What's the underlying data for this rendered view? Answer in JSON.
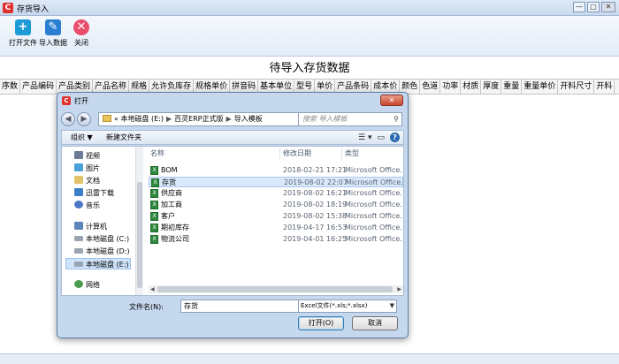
{
  "app": {
    "title": "存货导入",
    "window_buttons": [
      "—",
      "□",
      "✕"
    ]
  },
  "toolbar": {
    "items": [
      {
        "label": "打开文件",
        "icon": "add-file-icon",
        "glyph": "+"
      },
      {
        "label": "导入数据",
        "icon": "edit-import-icon",
        "glyph": "✎"
      },
      {
        "label": "关闭",
        "icon": "close-circle-icon",
        "glyph": "✕"
      }
    ]
  },
  "grid": {
    "title": "待导入存货数据",
    "columns": [
      "序数",
      "产品编码",
      "产品类别",
      "产品名称",
      "规格",
      "允许负库存",
      "规格单价",
      "拼音码",
      "基本单位",
      "型号",
      "单价",
      "产品条码",
      "成本价",
      "颜色",
      "色道",
      "功率",
      "材质",
      "厚度",
      "重量",
      "重量单价",
      "开料尺寸",
      "开料"
    ]
  },
  "dialog": {
    "title": "打开",
    "close_glyph": "✕",
    "address": {
      "prefix": "«",
      "parts": [
        "本地磁盘 (E:)",
        "百灵ERP正式版",
        "导入模板"
      ]
    },
    "search_placeholder": "搜索 导入模板",
    "commands": {
      "organize": "组织 ▼",
      "new_folder": "新建文件夹"
    },
    "nav_items": [
      {
        "label": "视频",
        "icon": "video-icon",
        "cls": "ni-video"
      },
      {
        "label": "图片",
        "icon": "picture-icon",
        "cls": "ni-pic"
      },
      {
        "label": "文档",
        "icon": "document-icon",
        "cls": "ni-doc"
      },
      {
        "label": "迅雷下载",
        "icon": "download-icon",
        "cls": "ni-dl"
      },
      {
        "label": "音乐",
        "icon": "music-icon",
        "cls": "ni-music"
      },
      {
        "label": "计算机",
        "icon": "computer-icon",
        "cls": "ni-pc"
      },
      {
        "label": "本地磁盘 (C:)",
        "icon": "disk-icon",
        "cls": "ni-disk"
      },
      {
        "label": "本地磁盘 (D:)",
        "icon": "disk-icon",
        "cls": "ni-disk"
      },
      {
        "label": "本地磁盘 (E:)",
        "icon": "disk-icon",
        "cls": "ni-disk",
        "selected": true
      },
      {
        "label": "网络",
        "icon": "network-icon",
        "cls": "ni-net"
      }
    ],
    "file_headers": {
      "name": "名称",
      "date": "修改日期",
      "type": "类型"
    },
    "files": [
      {
        "name": "BOM",
        "date": "2018-02-21 17:21",
        "type": "Microsoft Office..."
      },
      {
        "name": "存货",
        "date": "2019-08-02 22:07",
        "type": "Microsoft Office...",
        "selected": true
      },
      {
        "name": "供应商",
        "date": "2019-08-02 16:21",
        "type": "Microsoft Office..."
      },
      {
        "name": "加工商",
        "date": "2019-08-02 18:19",
        "type": "Microsoft Office..."
      },
      {
        "name": "客户",
        "date": "2019-08-02 15:38",
        "type": "Microsoft Office..."
      },
      {
        "name": "期初库存",
        "date": "2019-04-17 16:53",
        "type": "Microsoft Office..."
      },
      {
        "name": "物流公司",
        "date": "2019-04-01 16:25",
        "type": "Microsoft Office..."
      }
    ],
    "filename_label": "文件名(N):",
    "filename_value": "存货",
    "filetype_value": "Excel文件(*.xls;*.xlsx)",
    "open_button": "打开(O)",
    "cancel_button": "取消"
  }
}
